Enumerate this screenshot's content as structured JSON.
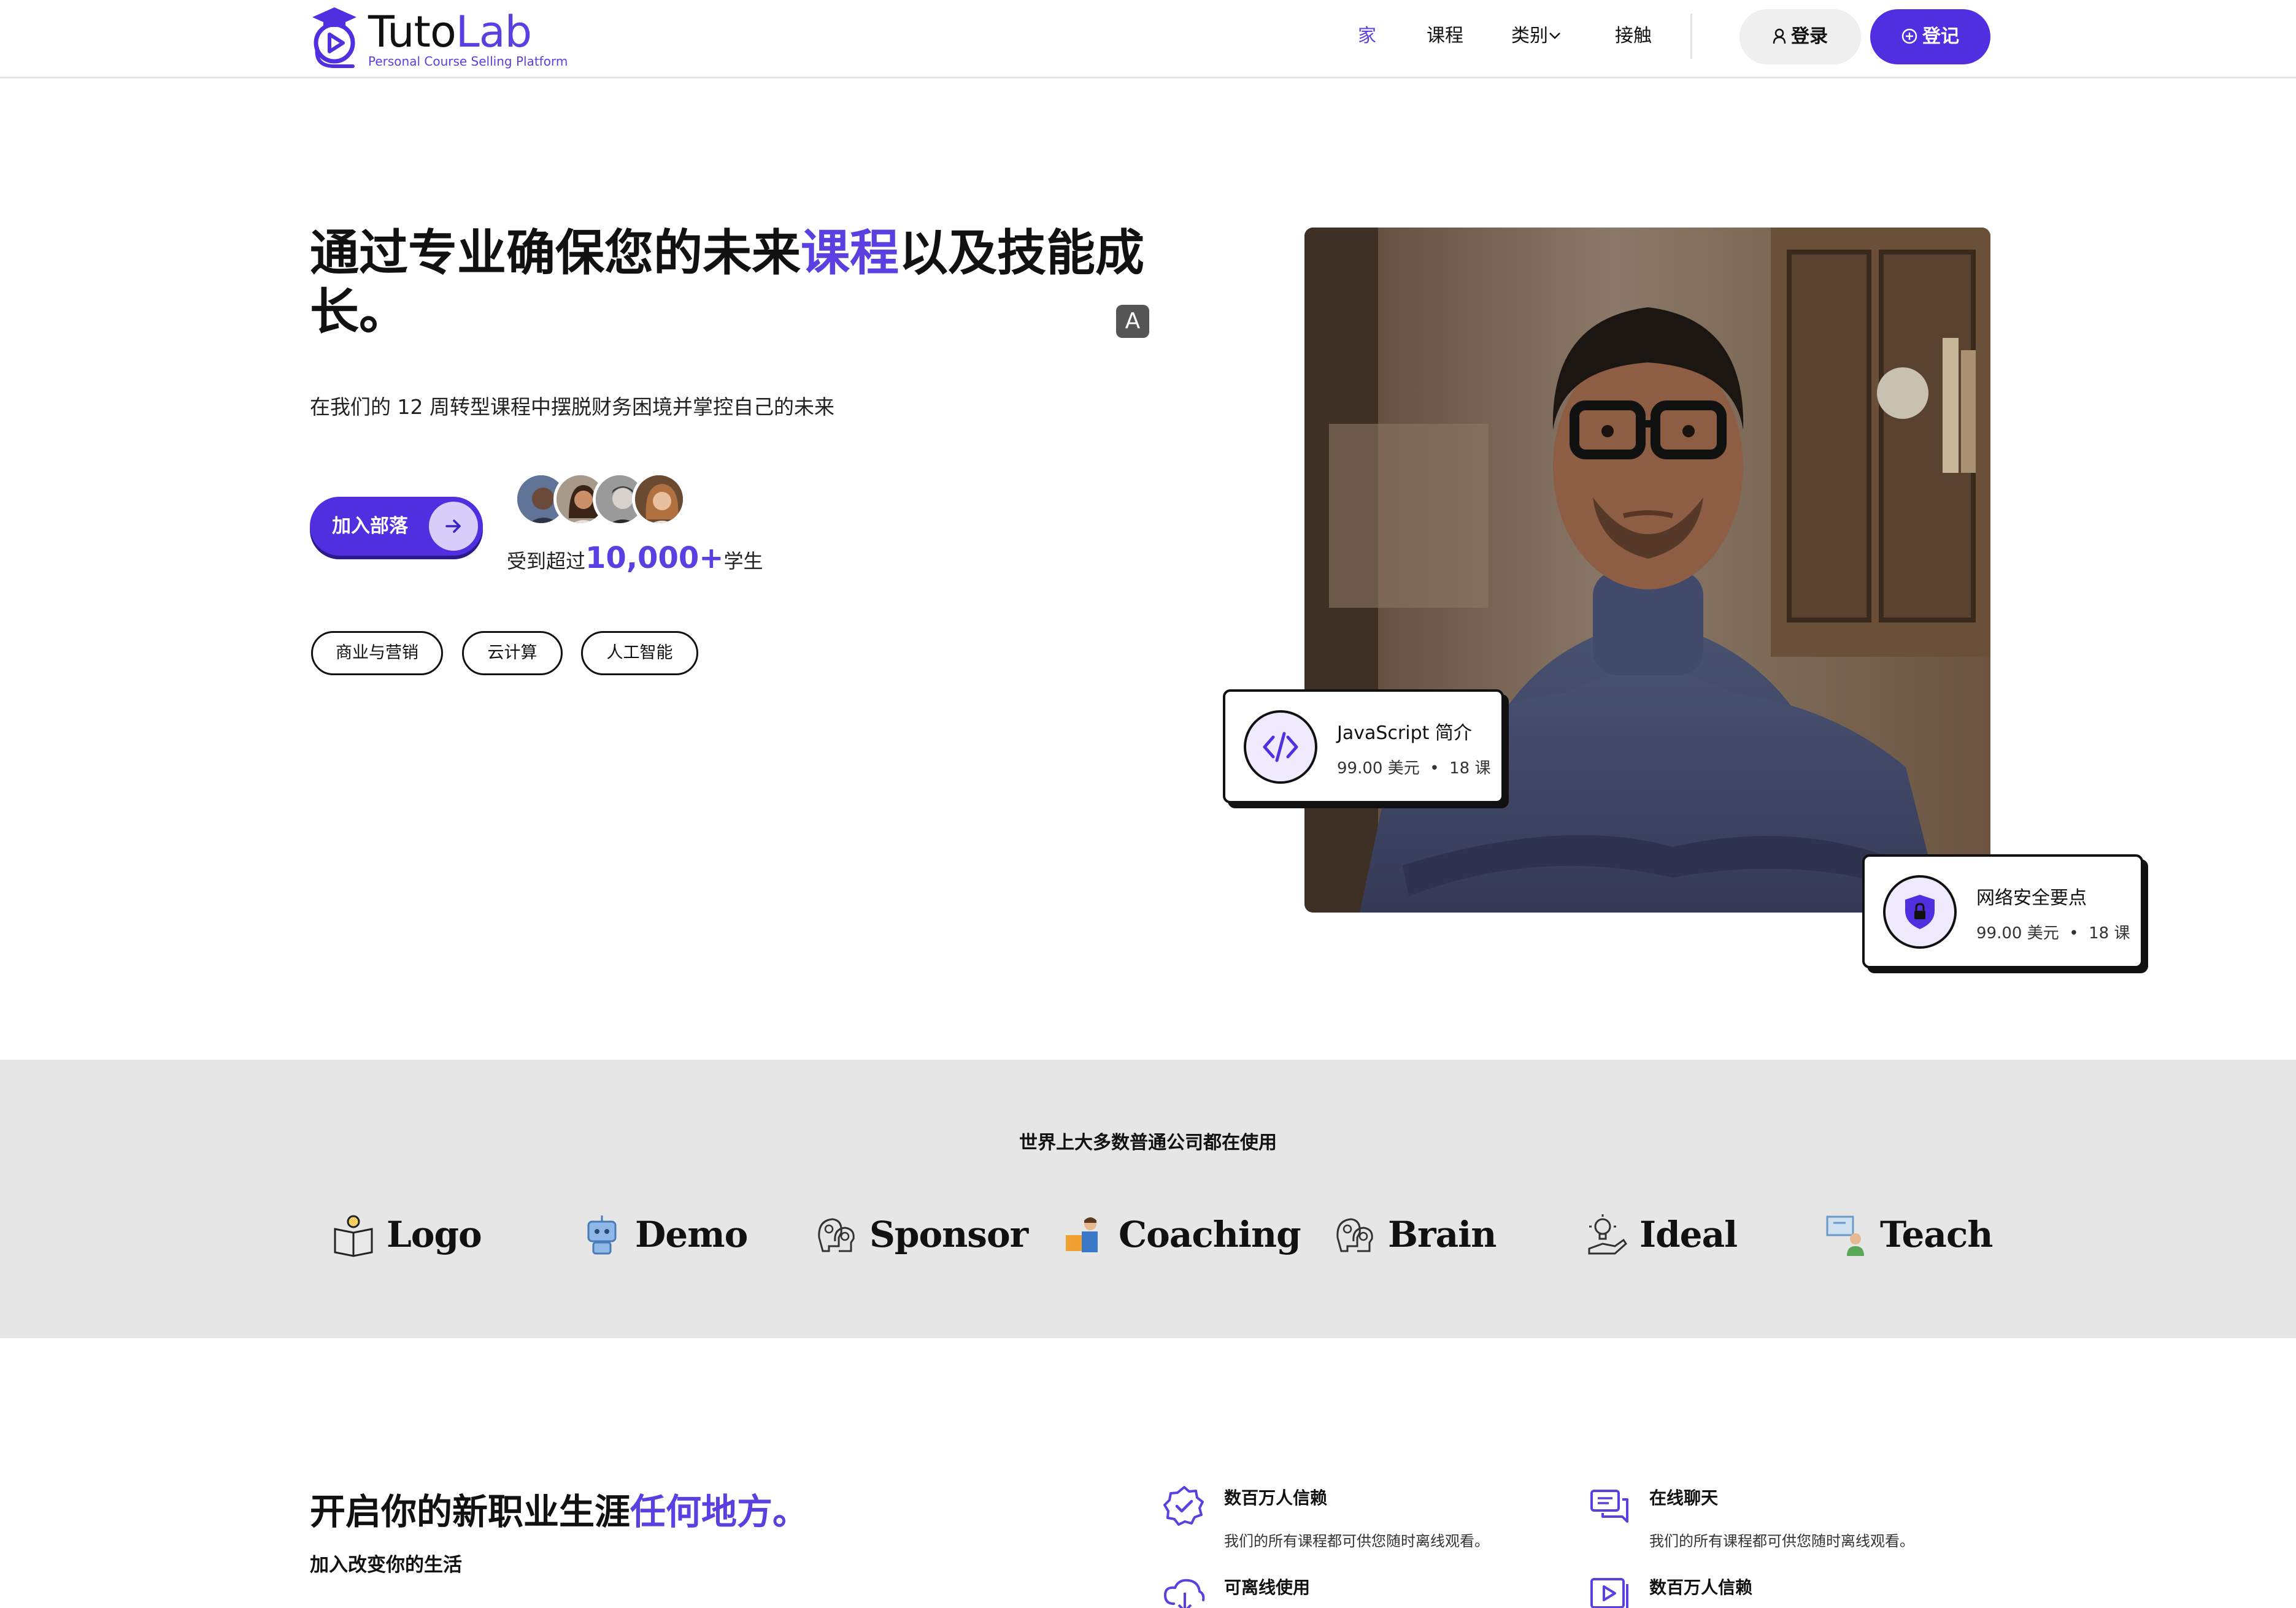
{
  "header": {
    "logo": {
      "word_a": "Tuto",
      "word_b": "Lab",
      "tagline": "Personal Course Selling Platform"
    },
    "nav": [
      {
        "label": "家",
        "active": true
      },
      {
        "label": "课程",
        "active": false
      },
      {
        "label": "类别",
        "active": false
      },
      {
        "label": "接触",
        "active": false
      }
    ],
    "login_label": "登录",
    "register_label": "登记"
  },
  "hero": {
    "title_part1": "通过专业确保您的未来",
    "title_accent": "课程",
    "title_part2": "以及技能成长。",
    "translate_badge": "A",
    "subtitle": "在我们的 12 周转型课程中摆脱财务困境并掌控自己的未来",
    "cta_label": "加入部落",
    "trust_prefix": "受到超过",
    "trust_number": "10,000+",
    "trust_suffix": "学生",
    "chips": [
      "商业与营销",
      "云计算",
      "人工智能"
    ]
  },
  "cards": [
    {
      "title": "JavaScript 简介",
      "price": "99.00 美元",
      "dot": "•",
      "lessons": "18 课",
      "icon": "code-icon"
    },
    {
      "title": "网络安全要点",
      "price": "99.00 美元",
      "dot": "•",
      "lessons": "18 课",
      "icon": "shield-lock-icon"
    }
  ],
  "partners": {
    "title": "世界上大多数普通公司都在使用",
    "items": [
      {
        "name": "Logo",
        "icon": "book-bulb-icon"
      },
      {
        "name": "Demo",
        "icon": "robot-icon"
      },
      {
        "name": "Sponsor",
        "icon": "brain-heads-icon"
      },
      {
        "name": "Coaching",
        "icon": "coach-icon"
      },
      {
        "name": "Brain",
        "icon": "brain-heads-icon"
      },
      {
        "name": "Ideal",
        "icon": "bulb-hand-icon"
      },
      {
        "name": "Teach",
        "icon": "teacher-board-icon"
      }
    ]
  },
  "career": {
    "title_part1": "开启你的新职业生涯",
    "title_accent": "任何地方。",
    "subtitle": "加入改变你的生活",
    "features": [
      {
        "title": "数百万人信赖",
        "text": "我们的所有课程都可供您随时离线观看。",
        "icon": "verified-badge-icon"
      },
      {
        "title": "在线聊天",
        "text": "我们的所有课程都可供您随时离线观看。",
        "icon": "chat-bubbles-icon"
      },
      {
        "title": "可离线使用",
        "text": "",
        "icon": "cloud-download-icon"
      },
      {
        "title": "数百万人信赖",
        "text": "",
        "icon": "play-box-icon"
      }
    ]
  },
  "colors": {
    "accent": "#5b3fe0",
    "band": "#e6e6e6",
    "text": "#111111"
  }
}
